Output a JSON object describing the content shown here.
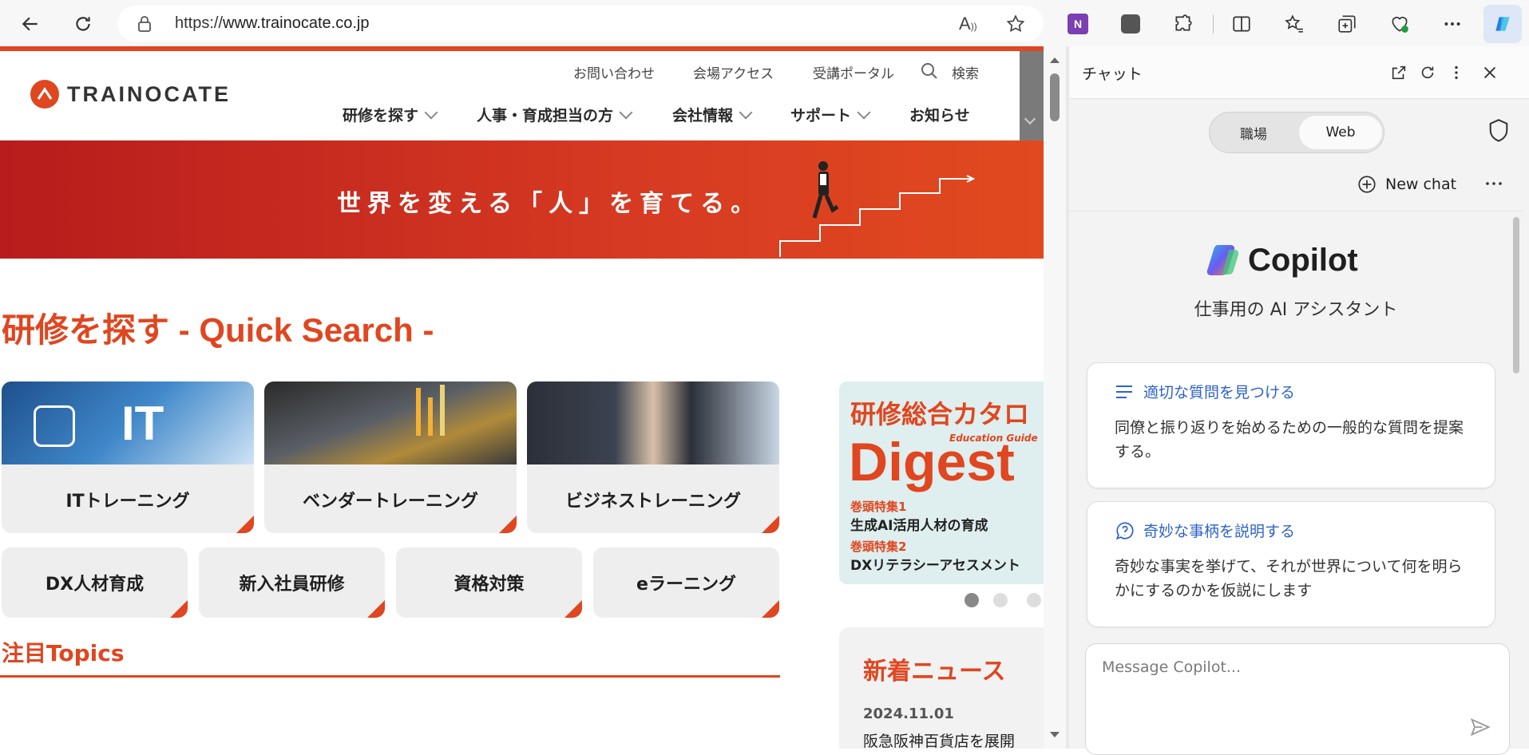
{
  "browser": {
    "url_prefix": "https://",
    "url_host": "www.trainocate.co.jp",
    "read_aloud_label": "A"
  },
  "site": {
    "logo_text": "TRAINOCATE",
    "util_links": [
      "お問い合わせ",
      "会場アクセス",
      "受講ポータル",
      "検索"
    ],
    "nav": [
      "研修を探す",
      "人事・育成担当の方",
      "会社情報",
      "サポート",
      "お知らせ"
    ],
    "hero_text": "世界を変える「人」を育てる。",
    "quick_search_title": "研修を探す - Quick Search -",
    "big_cards": [
      {
        "label": "ITトレーニング",
        "image_text": "IT"
      },
      {
        "label": "ベンダートレーニング"
      },
      {
        "label": "ビジネストレーニング"
      }
    ],
    "small_cards": [
      "DX人材育成",
      "新入社員研修",
      "資格対策",
      "eラーニング"
    ],
    "catalog": {
      "title": "研修総合カタロ",
      "small": "Education Guide",
      "big": "Digest",
      "feature1_label": "巻頭特集1",
      "feature1": "生成AI活用人材の育成",
      "feature2_label": "巻頭特集2",
      "feature2": "DXリテラシーアセスメント"
    },
    "news": {
      "title": "新着ニュース",
      "date": "2024.11.01",
      "headline": "阪急阪神百貨店を展開"
    },
    "topics_title": "注目Topics"
  },
  "copilot": {
    "pane_title": "チャット",
    "toggle_work": "職場",
    "toggle_web": "Web",
    "new_chat": "New chat",
    "title": "Copilot",
    "subtitle": "仕事用の AI アシスタント",
    "suggestions": [
      {
        "title": "適切な質問を見つける",
        "body": "同僚と振り返りを始めるための一般的な質問を提案する。"
      },
      {
        "title": "奇妙な事柄を説明する",
        "body": "奇妙な事実を挙げて、それが世界について何を明らかにするのかを仮説にします"
      }
    ],
    "composer_placeholder": "Message Copilot..."
  },
  "colors": {
    "brand": "#e0461f",
    "link_blue": "#2e62c9"
  }
}
